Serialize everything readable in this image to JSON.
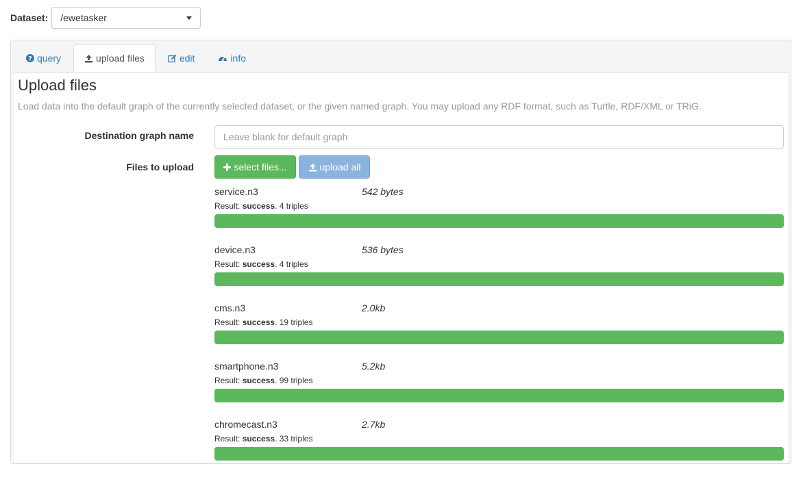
{
  "dataset": {
    "label": "Dataset:",
    "value": "/ewetasker"
  },
  "tabs": [
    {
      "label": "query",
      "icon": "question-circle-icon"
    },
    {
      "label": "upload files",
      "icon": "upload-icon"
    },
    {
      "label": "edit",
      "icon": "edit-icon"
    },
    {
      "label": "info",
      "icon": "dashboard-icon"
    }
  ],
  "active_tab": "upload files",
  "upload": {
    "title": "Upload files",
    "description": "Load data into the default graph of the currently selected dataset, or the given named graph. You may upload any RDF format, such as Turtle, RDF/XML or TRiG.",
    "dest_label": "Destination graph name",
    "dest_placeholder": "Leave blank for default graph",
    "files_label": "Files to upload",
    "select_button": "select files...",
    "upload_all_button": "upload all",
    "result_prefix": "Result:"
  },
  "files": [
    {
      "name": "service.n3",
      "size": "542 bytes",
      "status": "success",
      "triples": ". 4 triples",
      "progress": 1.0
    },
    {
      "name": "device.n3",
      "size": "536 bytes",
      "status": "success",
      "triples": ". 4 triples",
      "progress": 1.0
    },
    {
      "name": "cms.n3",
      "size": "2.0kb",
      "status": "success",
      "triples": ". 19 triples",
      "progress": 1.0
    },
    {
      "name": "smartphone.n3",
      "size": "5.2kb",
      "status": "success",
      "triples": ". 99 triples",
      "progress": 1.0
    },
    {
      "name": "chromecast.n3",
      "size": "2.7kb",
      "status": "success",
      "triples": ". 33 triples",
      "progress": 1.0
    }
  ],
  "colors": {
    "success": "#5cb85c",
    "link": "#337ab7",
    "upload_all_disabled": "#8ab4dd"
  }
}
